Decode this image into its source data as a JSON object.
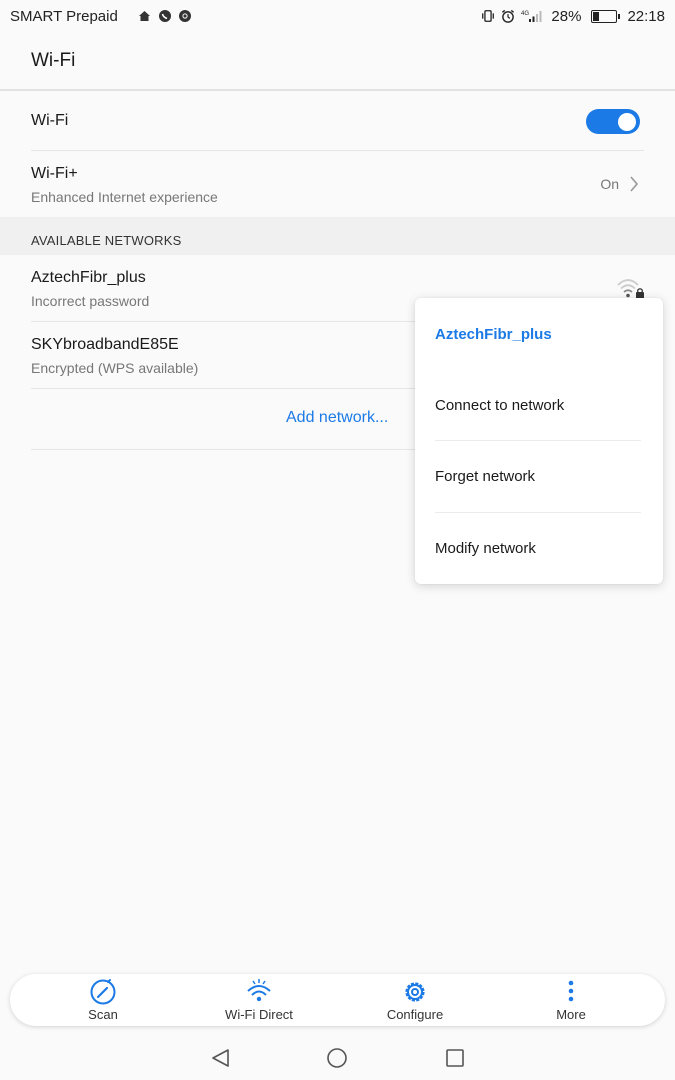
{
  "status_bar": {
    "carrier": "SMART Prepaid",
    "left_icons": [
      "home-icon",
      "whatsapp-icon",
      "chrome-icon"
    ],
    "right_icons": [
      "vibrate-icon",
      "alarm-icon",
      "signal-4g-icon"
    ],
    "battery_percent": "28%",
    "battery_level": 0.28,
    "time": "22:18"
  },
  "header": {
    "title": "Wi-Fi"
  },
  "wifi_row": {
    "label": "Wi-Fi",
    "enabled": true
  },
  "wifiplus_row": {
    "label": "Wi-Fi+",
    "subtitle": "Enhanced Internet experience",
    "value": "On"
  },
  "section": {
    "label": "AVAILABLE NETWORKS"
  },
  "networks": [
    {
      "name": "AztechFibr_plus",
      "status": "Incorrect password"
    },
    {
      "name": "SKYbroadbandE85E",
      "status": "Encrypted (WPS available)"
    }
  ],
  "add_network": {
    "label": "Add network..."
  },
  "popup": {
    "title": "AztechFibr_plus",
    "items": [
      "Connect to network",
      "Forget network",
      "Modify network"
    ]
  },
  "bottom_tabs": [
    {
      "label": "Scan",
      "icon": "scan-icon"
    },
    {
      "label": "Wi-Fi Direct",
      "icon": "wifi-direct-icon"
    },
    {
      "label": "Configure",
      "icon": "gear-icon"
    },
    {
      "label": "More",
      "icon": "more-vertical-icon"
    }
  ],
  "nav": [
    "back-icon",
    "home-circle-icon",
    "recents-icon"
  ],
  "colors": {
    "accent": "#1b7ae6",
    "background": "#fafafa",
    "section_bg": "#f0f0f0"
  }
}
